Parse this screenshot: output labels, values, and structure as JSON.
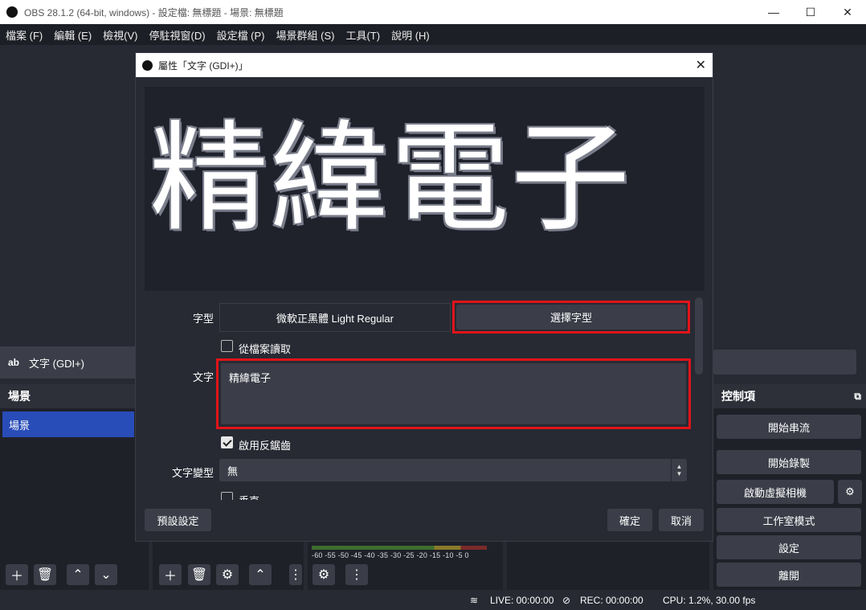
{
  "window": {
    "title": "OBS 28.1.2 (64-bit, windows) - 設定檔: 無標題 - 場景: 無標題"
  },
  "menu": [
    "檔案 (F)",
    "編輯 (E)",
    "檢視(V)",
    "停駐視窗(D)",
    "設定檔 (P)",
    "場景群組 (S)",
    "工具(T)",
    "說明 (H)"
  ],
  "source_bar": {
    "icon": "ab",
    "label": "文字 (GDI+)"
  },
  "scenes_dock": {
    "title": "場景",
    "items": [
      "場景"
    ]
  },
  "controls_dock": {
    "title": "控制項",
    "buttons": [
      "開始串流",
      "開始錄製",
      "啟動虛擬相機",
      "工作室模式",
      "設定",
      "離開"
    ]
  },
  "mixer": {
    "ticks": "-60 -55 -50 -45 -40 -35 -30 -25 -20 -15 -10 -5 0"
  },
  "status": {
    "live": "LIVE: 00:00:00",
    "rec": "REC: 00:00:00",
    "cpu": "CPU: 1.2%, 30.00 fps"
  },
  "dialog": {
    "title": "屬性「文字 (GDI+)」",
    "preview_text": "精緯電子",
    "font_label": "字型",
    "font_value": "微軟正黑體 Light Regular",
    "choose_font_button": "選擇字型",
    "read_from_file_label": "從檔案讀取",
    "read_from_file_checked": false,
    "text_label": "文字",
    "text_value": "精緯電子",
    "antialias_label": "啟用反鋸齒",
    "antialias_checked": true,
    "transform_label": "文字變型",
    "transform_value": "無",
    "vertical_label": "垂直",
    "defaults_button": "預設設定",
    "ok_button": "確定",
    "cancel_button": "取消"
  },
  "colors": {
    "accent_selected": "#284cb8",
    "highlight_box": "#e0141a",
    "dark_bg": "#272a33",
    "button_bg": "#3b3e48"
  }
}
